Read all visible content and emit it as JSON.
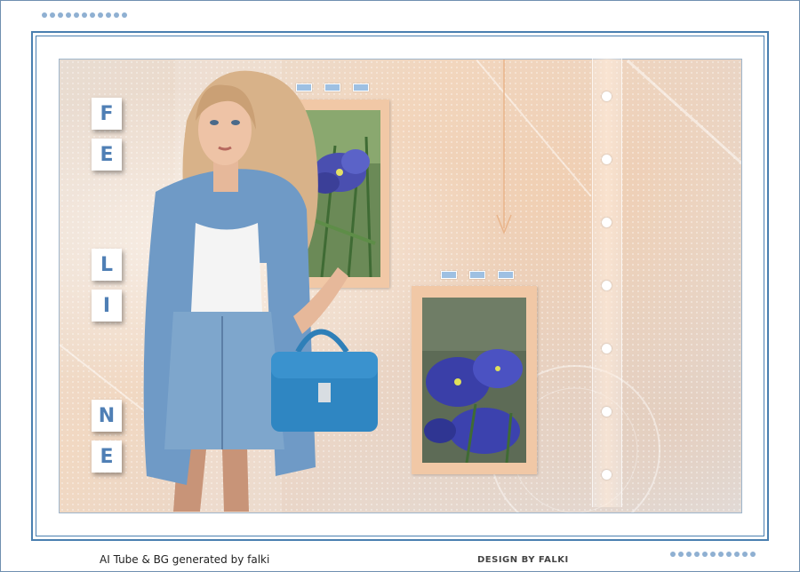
{
  "banner": {
    "letters": [
      "F",
      "E",
      "L",
      "I",
      "N",
      "E"
    ],
    "footer_left": "AI Tube & BG generated by falki",
    "footer_right": "DESIGN BY FALKI"
  },
  "colors": {
    "frame": "#4a7fb0",
    "letter": "#4f7fb5",
    "dots": "#8fb0d2",
    "photo_frame": "#f1c8a6",
    "background_warm": "#f1d8c2"
  },
  "icons": {
    "top_left_dots": "dotted-row",
    "bottom_right_dots": "dotted-row",
    "strip_dots": "white-dot"
  }
}
